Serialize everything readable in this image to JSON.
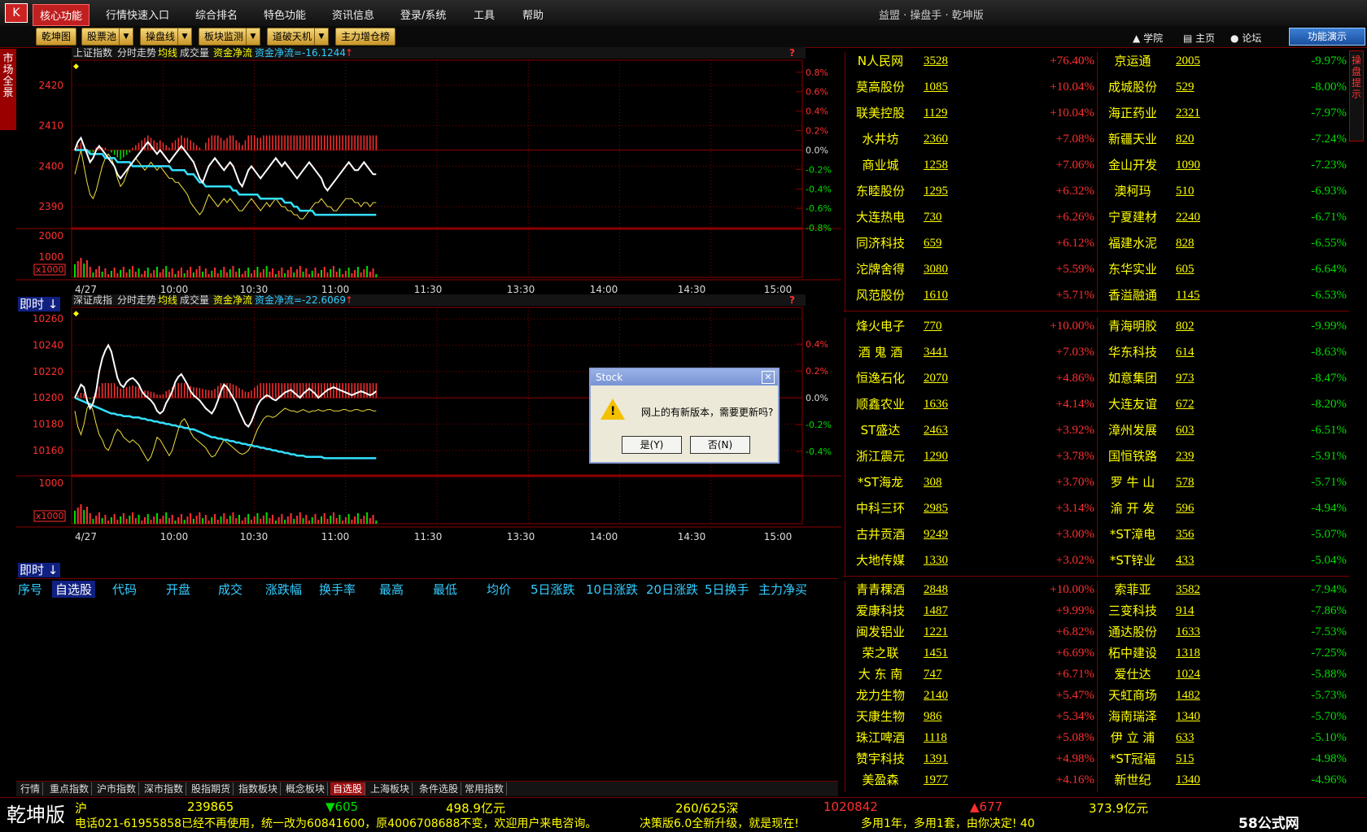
{
  "menubar": {
    "logo": "K",
    "items": [
      "核心功能",
      "行情快速入口",
      "综合排名",
      "特色功能",
      "资讯信息",
      "登录/系统",
      "工具",
      "帮助"
    ],
    "app_title": "益盟 · 操盘手 · 乾坤版"
  },
  "toolbar": {
    "buttons": [
      "乾坤图",
      "股票池",
      "操盘线",
      "板块监测",
      "道破天机",
      "主力增仓榜"
    ],
    "links": [
      "学院",
      "主页",
      "论坛"
    ],
    "demo": "功能演示"
  },
  "left_strip": "市场全景",
  "right_strip": "操盘提示",
  "chart_data": [
    {
      "type": "line",
      "title": "上证指数",
      "header_items": [
        "分时走势",
        "均线",
        "成交量",
        "资金净流"
      ],
      "net_flow_label": "资金净流=-16.1244",
      "y_ticks": [
        2420,
        2410,
        2400,
        2390
      ],
      "pct_ticks": [
        "0.8%",
        "0.6%",
        "0.4%",
        "0.2%",
        "0.0%",
        "-0.2%",
        "-0.4%",
        "-0.6%",
        "-0.8%"
      ],
      "vol_ticks": [
        "2000",
        "1000"
      ],
      "vol_unit": "x1000",
      "x_ticks": [
        "4/27",
        "10:00",
        "10:30",
        "11:00",
        "11:30",
        "13:30",
        "14:00",
        "14:30",
        "15:00"
      ],
      "ylim": [
        2386,
        2425
      ],
      "price": [
        2404,
        2406,
        2407,
        2405,
        2403,
        2401,
        2402,
        2404,
        2405,
        2404,
        2403,
        2402,
        2401,
        2400,
        2398,
        2397,
        2398,
        2399,
        2400,
        2401,
        2402,
        2403,
        2404,
        2405,
        2406,
        2405,
        2404,
        2403,
        2404,
        2403,
        2402,
        2401,
        2402,
        2403,
        2404,
        2405,
        2404,
        2403,
        2402,
        2401,
        2399,
        2397,
        2396,
        2398,
        2400,
        2401,
        2402,
        2401,
        2400,
        2399,
        2400,
        2401,
        2400,
        2398,
        2396,
        2395,
        2397,
        2399,
        2400,
        2399,
        2398,
        2397,
        2398,
        2399,
        2400,
        2401,
        2402,
        2401,
        2400,
        2401,
        2400,
        2399,
        2398,
        2397,
        2398,
        2399,
        2400,
        2401,
        2400,
        2399,
        2398,
        2397,
        2395,
        2394,
        2395,
        2396,
        2397,
        2398,
        2399,
        2400,
        2401,
        2400,
        2399,
        2399,
        2400,
        2401,
        2400,
        2399,
        2398,
        2398
      ],
      "avg": [
        2404,
        2404,
        2404,
        2404,
        2404,
        2403,
        2403,
        2403,
        2403,
        2403,
        2402,
        2402,
        2402,
        2402,
        2401,
        2401,
        2401,
        2401,
        2401,
        2400,
        2400,
        2400,
        2400,
        2400,
        2400,
        2400,
        2400,
        2400,
        2400,
        2400,
        2400,
        2400,
        2399,
        2399,
        2399,
        2399,
        2399,
        2398,
        2398,
        2398,
        2397,
        2396,
        2396,
        2395,
        2395,
        2395,
        2395,
        2395,
        2395,
        2395,
        2395,
        2395,
        2394,
        2394,
        2393,
        2393,
        2393,
        2393,
        2393,
        2393,
        2393,
        2392,
        2392,
        2392,
        2392,
        2392,
        2392,
        2392,
        2392,
        2391,
        2391,
        2391,
        2390,
        2390,
        2389,
        2389,
        2389,
        2389,
        2389,
        2388,
        2388,
        2388,
        2388,
        2388,
        2388,
        2388,
        2388,
        2388,
        2388,
        2388,
        2388,
        2388,
        2388,
        2388,
        2388,
        2388,
        2388,
        2388,
        2388,
        2388
      ],
      "yellow": [
        2398,
        2401,
        2404,
        2400,
        2396,
        2393,
        2392,
        2394,
        2397,
        2400,
        2402,
        2403,
        2402,
        2400,
        2397,
        2395,
        2396,
        2398,
        2400,
        2401,
        2402,
        2401,
        2400,
        2399,
        2400,
        2401,
        2400,
        2399,
        2400,
        2399,
        2398,
        2397,
        2397,
        2396,
        2396,
        2395,
        2394,
        2393,
        2391,
        2390,
        2389,
        2388,
        2389,
        2391,
        2393,
        2392,
        2391,
        2390,
        2391,
        2392,
        2391,
        2392,
        2391,
        2390,
        2389,
        2389,
        2390,
        2391,
        2392,
        2391,
        2390,
        2389,
        2390,
        2391,
        2390,
        2391,
        2392,
        2391,
        2390,
        2390,
        2389,
        2389,
        2388,
        2388,
        2387,
        2387,
        2388,
        2389,
        2390,
        2391,
        2391,
        2392,
        2391,
        2390,
        2390,
        2389,
        2389,
        2390,
        2391,
        2392,
        2392,
        2392,
        2391,
        2391,
        2390,
        2391,
        2391,
        2390,
        2391,
        2391
      ]
    },
    {
      "type": "line",
      "title": "深证成指",
      "header_items": [
        "分时走势",
        "均线",
        "成交量",
        "资金净流"
      ],
      "net_flow_label": "资金净流=-22.6069",
      "y_ticks": [
        10260,
        10240,
        10220,
        10200,
        10180,
        10160
      ],
      "pct_ticks": [
        "0.4%",
        "0.2%",
        "0.0%",
        "-0.2%",
        "-0.4%"
      ],
      "vol_ticks": [
        "1000"
      ],
      "vol_unit": "x1000",
      "x_ticks": [
        "4/27",
        "10:00",
        "10:30",
        "11:00",
        "11:30",
        "13:30",
        "14:00",
        "14:30",
        "15:00"
      ],
      "ylim": [
        10145,
        10265
      ],
      "price": [
        10200,
        10205,
        10210,
        10208,
        10198,
        10192,
        10196,
        10205,
        10220,
        10230,
        10236,
        10240,
        10235,
        10225,
        10215,
        10210,
        10208,
        10212,
        10214,
        10215,
        10213,
        10210,
        10205,
        10202,
        10200,
        10198,
        10195,
        10190,
        10188,
        10190,
        10196,
        10200,
        10205,
        10212,
        10216,
        10218,
        10214,
        10210,
        10205,
        10202,
        10200,
        10198,
        10195,
        10192,
        10190,
        10188,
        10192,
        10198,
        10205,
        10210,
        10208,
        10204,
        10200,
        10196,
        10190,
        10185,
        10180,
        10178,
        10182,
        10188,
        10194,
        10198,
        10200,
        10202,
        10201,
        10199,
        10198,
        10200,
        10202,
        10204,
        10205,
        10206,
        10204,
        10202,
        10200,
        10203,
        10205,
        10207,
        10205,
        10203,
        10200,
        10202,
        10204,
        10206,
        10207,
        10208,
        10207,
        10206,
        10205,
        10204,
        10203,
        10202,
        10203,
        10204,
        10205,
        10204,
        10203,
        10202,
        10203,
        10205
      ],
      "avg": [
        10200,
        10199,
        10198,
        10197,
        10196,
        10195,
        10194,
        10193,
        10192,
        10191,
        10190,
        10189,
        10188,
        10188,
        10187,
        10187,
        10186,
        10186,
        10186,
        10185,
        10185,
        10185,
        10184,
        10184,
        10183,
        10183,
        10182,
        10182,
        10181,
        10181,
        10180,
        10180,
        10179,
        10179,
        10178,
        10178,
        10177,
        10177,
        10176,
        10176,
        10175,
        10174,
        10173,
        10172,
        10171,
        10170,
        10170,
        10169,
        10169,
        10168,
        10168,
        10167,
        10167,
        10166,
        10166,
        10165,
        10165,
        10164,
        10164,
        10163,
        10163,
        10162,
        10162,
        10161,
        10161,
        10160,
        10160,
        10159,
        10159,
        10158,
        10158,
        10157,
        10157,
        10156,
        10156,
        10156,
        10155,
        10155,
        10155,
        10155,
        10155,
        10155,
        10154,
        10154,
        10154,
        10154,
        10154,
        10154,
        10154,
        10154,
        10154,
        10154,
        10154,
        10154,
        10154,
        10154,
        10154,
        10154,
        10154,
        10154
      ],
      "yellow": [
        10190,
        10178,
        10172,
        10180,
        10192,
        10196,
        10190,
        10180,
        10172,
        10168,
        10162,
        10160,
        10165,
        10172,
        10176,
        10174,
        10170,
        10168,
        10166,
        10168,
        10166,
        10164,
        10160,
        10156,
        10152,
        10155,
        10162,
        10170,
        10168,
        10164,
        10160,
        10156,
        10160,
        10168,
        10176,
        10182,
        10184,
        10180,
        10174,
        10170,
        10168,
        10166,
        10164,
        10162,
        10158,
        10155,
        10156,
        10160,
        10164,
        10168,
        10166,
        10164,
        10162,
        10160,
        10158,
        10157,
        10158,
        10160,
        10164,
        10170,
        10176,
        10180,
        10184,
        10186,
        10186,
        10185,
        10186,
        10188,
        10190,
        10192,
        10191,
        10190,
        10190,
        10189,
        10190,
        10191,
        10190,
        10189,
        10190,
        10190,
        10191,
        10190,
        10190,
        10191,
        10191,
        10190,
        10190,
        10190,
        10191,
        10191,
        10190,
        10190,
        10191,
        10191,
        10190,
        10190,
        10191,
        10191,
        10190,
        10190
      ]
    }
  ],
  "timebtn": "即时",
  "stocks": {
    "t1_left": [
      {
        "name": "N人民网",
        "price": "3528",
        "chg": "+76.40%"
      },
      {
        "name": "莫高股份",
        "price": "1085",
        "chg": "+10.04%"
      },
      {
        "name": "联美控股",
        "price": "1129",
        "chg": "+10.04%"
      },
      {
        "name": "水井坊",
        "price": "2360",
        "chg": "+7.08%"
      },
      {
        "name": "商业城",
        "price": "1258",
        "chg": "+7.06%"
      },
      {
        "name": "东睦股份",
        "price": "1295",
        "chg": "+6.32%"
      },
      {
        "name": "大连热电",
        "price": "730",
        "chg": "+6.26%"
      },
      {
        "name": "同济科技",
        "price": "659",
        "chg": "+6.12%"
      },
      {
        "name": "沱牌舍得",
        "price": "3080",
        "chg": "+5.59%"
      },
      {
        "name": "风范股份",
        "price": "1610",
        "chg": "+5.71%"
      }
    ],
    "t1_right": [
      {
        "name": "京运通",
        "price": "2005",
        "chg": "-9.97%"
      },
      {
        "name": "成城股份",
        "price": "529",
        "chg": "-8.00%"
      },
      {
        "name": "海正药业",
        "price": "2321",
        "chg": "-7.97%"
      },
      {
        "name": "新疆天业",
        "price": "820",
        "chg": "-7.24%"
      },
      {
        "name": "金山开发",
        "price": "1090",
        "chg": "-7.23%"
      },
      {
        "name": "澳柯玛",
        "price": "510",
        "chg": "-6.93%"
      },
      {
        "name": "宁夏建材",
        "price": "2240",
        "chg": "-6.71%"
      },
      {
        "name": "福建水泥",
        "price": "828",
        "chg": "-6.55%"
      },
      {
        "name": "东华实业",
        "price": "605",
        "chg": "-6.64%"
      },
      {
        "name": "香溢融通",
        "price": "1145",
        "chg": "-6.53%"
      }
    ],
    "t2_left": [
      {
        "name": "烽火电子",
        "price": "770",
        "chg": "+10.00%"
      },
      {
        "name": "酒 鬼 酒",
        "price": "3441",
        "chg": "+7.03%"
      },
      {
        "name": "恒逸石化",
        "price": "2070",
        "chg": "+4.86%"
      },
      {
        "name": "顺鑫农业",
        "price": "1636",
        "chg": "+4.14%"
      },
      {
        "name": "ST盛达",
        "price": "2463",
        "chg": "+3.92%"
      },
      {
        "name": "浙江震元",
        "price": "1290",
        "chg": "+3.78%"
      },
      {
        "name": "*ST海龙",
        "price": "308",
        "chg": "+3.70%"
      },
      {
        "name": "中科三环",
        "price": "2985",
        "chg": "+3.14%"
      },
      {
        "name": "古井贡酒",
        "price": "9249",
        "chg": "+3.00%"
      },
      {
        "name": "大地传媒",
        "price": "1330",
        "chg": "+3.02%"
      }
    ],
    "t2_right": [
      {
        "name": "青海明胶",
        "price": "802",
        "chg": "-9.99%"
      },
      {
        "name": "华东科技",
        "price": "614",
        "chg": "-8.63%"
      },
      {
        "name": "如意集团",
        "price": "973",
        "chg": "-8.47%"
      },
      {
        "name": "大连友谊",
        "price": "672",
        "chg": "-8.20%"
      },
      {
        "name": "漳州发展",
        "price": "603",
        "chg": "-6.51%"
      },
      {
        "name": "国恒铁路",
        "price": "239",
        "chg": "-5.91%"
      },
      {
        "name": "罗 牛 山",
        "price": "578",
        "chg": "-5.71%"
      },
      {
        "name": "渝 开 发",
        "price": "596",
        "chg": "-4.94%"
      },
      {
        "name": "*ST漳电",
        "price": "356",
        "chg": "-5.07%"
      },
      {
        "name": "*ST锌业",
        "price": "433",
        "chg": "-5.04%"
      }
    ],
    "t3_left": [
      {
        "name": "青青稞酒",
        "price": "2848",
        "chg": "+10.00%"
      },
      {
        "name": "爱康科技",
        "price": "1487",
        "chg": "+9.99%"
      },
      {
        "name": "闽发铝业",
        "price": "1221",
        "chg": "+6.82%"
      },
      {
        "name": "荣之联",
        "price": "1451",
        "chg": "+6.69%"
      },
      {
        "name": "大 东 南",
        "price": "747",
        "chg": "+6.71%"
      },
      {
        "name": "龙力生物",
        "price": "2140",
        "chg": "+5.47%"
      },
      {
        "name": "天康生物",
        "price": "986",
        "chg": "+5.34%"
      },
      {
        "name": "珠江啤酒",
        "price": "1118",
        "chg": "+5.08%"
      },
      {
        "name": "赞宇科技",
        "price": "1391",
        "chg": "+4.98%"
      },
      {
        "name": "美盈森",
        "price": "1977",
        "chg": "+4.16%"
      }
    ],
    "t3_right": [
      {
        "name": "索菲亚",
        "price": "3582",
        "chg": "-7.94%"
      },
      {
        "name": "三变科技",
        "price": "914",
        "chg": "-7.86%"
      },
      {
        "name": "通达股份",
        "price": "1633",
        "chg": "-7.53%"
      },
      {
        "name": "柘中建设",
        "price": "1318",
        "chg": "-7.25%"
      },
      {
        "name": "爱仕达",
        "price": "1024",
        "chg": "-5.88%"
      },
      {
        "name": "天虹商场",
        "price": "1482",
        "chg": "-5.73%"
      },
      {
        "name": "海南瑞泽",
        "price": "1340",
        "chg": "-5.70%"
      },
      {
        "name": "伊 立 浦",
        "price": "633",
        "chg": "-5.10%"
      },
      {
        "name": "*ST冠福",
        "price": "515",
        "chg": "-4.98%"
      },
      {
        "name": "新世纪",
        "price": "1340",
        "chg": "-4.96%"
      }
    ]
  },
  "columns": [
    "序号",
    "自选股",
    "代码",
    "开盘",
    "成交",
    "涨跌幅",
    "换手率",
    "最高",
    "最低",
    "均价",
    "5日涨跌",
    "10日涨跌",
    "20日涨跌",
    "5日换手",
    "主力净买"
  ],
  "tabs": [
    "行情",
    "重点指数",
    "沪市指数",
    "深市指数",
    "股指期货",
    "指数板块",
    "概念板块",
    "自选股",
    "上海板块",
    "条件选股",
    "常用指数"
  ],
  "status": {
    "brand": "乾坤版",
    "sh_label": "沪",
    "sh_index": "239865",
    "sh_change": "▼605",
    "sh_amount": "498.9亿元",
    "adv_dec": "260/625深",
    "sz_index": "1020842",
    "sz_change": "▲677",
    "sz_amount": "373.9亿元",
    "ticker1": "电话021-61955858已经不再使用，统一改为60841600，原4006708688不变，欢迎用户来电咨询。",
    "ticker2": "决策版6.0全新升级，就是现在!",
    "ticker3": "多用1年，多用1套，由你决定! 40",
    "watermark": "58公式网"
  },
  "dialog": {
    "title": "Stock",
    "message": "网上的有新版本，需要更新吗?",
    "yes": "是(Y)",
    "no": "否(N)"
  },
  "colors": {
    "up": "#ff3030",
    "down": "#00dd00",
    "grid": "#8b0000",
    "price": "#ffffff",
    "avg": "#33e0ff",
    "yellow": "#f0e040"
  }
}
